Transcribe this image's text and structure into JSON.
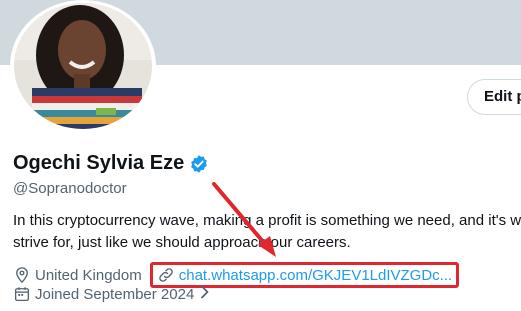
{
  "profile": {
    "display_name": "Ogechi Sylvia Eze",
    "handle": "@Sopranodoctor",
    "verified": true,
    "bio_line1": "In this cryptocurrency wave, making a profit is something we need, and it's w",
    "bio_line2": "strive for, just like we should approach our careers.",
    "location": "United Kingdom",
    "website": "chat.whatsapp.com/GKJEV1LdIVZGDc...",
    "joined": "Joined September 2024"
  },
  "actions": {
    "edit_label": "Edit p"
  },
  "icons": {
    "verified": "verified-badge-icon",
    "location": "location-pin-icon",
    "link": "link-icon",
    "calendar": "calendar-icon",
    "chevron": "chevron-right-icon"
  },
  "colors": {
    "banner": "#cfd9de",
    "link": "#1d9bf0",
    "verified": "#1d9bf0",
    "highlight": "#e0272f",
    "muted": "#536471"
  }
}
